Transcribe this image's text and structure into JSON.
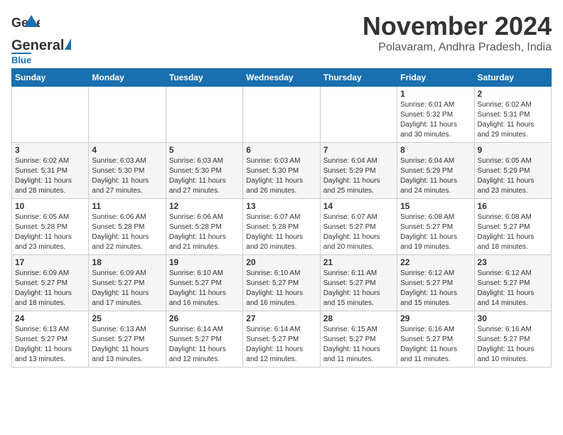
{
  "header": {
    "logo_general": "General",
    "logo_blue": "Blue",
    "month_title": "November 2024",
    "location": "Polavaram, Andhra Pradesh, India"
  },
  "weekdays": [
    "Sunday",
    "Monday",
    "Tuesday",
    "Wednesday",
    "Thursday",
    "Friday",
    "Saturday"
  ],
  "weeks": [
    [
      {
        "day": "",
        "info": ""
      },
      {
        "day": "",
        "info": ""
      },
      {
        "day": "",
        "info": ""
      },
      {
        "day": "",
        "info": ""
      },
      {
        "day": "",
        "info": ""
      },
      {
        "day": "1",
        "info": "Sunrise: 6:01 AM\nSunset: 5:32 PM\nDaylight: 11 hours\nand 30 minutes."
      },
      {
        "day": "2",
        "info": "Sunrise: 6:02 AM\nSunset: 5:31 PM\nDaylight: 11 hours\nand 29 minutes."
      }
    ],
    [
      {
        "day": "3",
        "info": "Sunrise: 6:02 AM\nSunset: 5:31 PM\nDaylight: 11 hours\nand 28 minutes."
      },
      {
        "day": "4",
        "info": "Sunrise: 6:03 AM\nSunset: 5:30 PM\nDaylight: 11 hours\nand 27 minutes."
      },
      {
        "day": "5",
        "info": "Sunrise: 6:03 AM\nSunset: 5:30 PM\nDaylight: 11 hours\nand 27 minutes."
      },
      {
        "day": "6",
        "info": "Sunrise: 6:03 AM\nSunset: 5:30 PM\nDaylight: 11 hours\nand 26 minutes."
      },
      {
        "day": "7",
        "info": "Sunrise: 6:04 AM\nSunset: 5:29 PM\nDaylight: 11 hours\nand 25 minutes."
      },
      {
        "day": "8",
        "info": "Sunrise: 6:04 AM\nSunset: 5:29 PM\nDaylight: 11 hours\nand 24 minutes."
      },
      {
        "day": "9",
        "info": "Sunrise: 6:05 AM\nSunset: 5:29 PM\nDaylight: 11 hours\nand 23 minutes."
      }
    ],
    [
      {
        "day": "10",
        "info": "Sunrise: 6:05 AM\nSunset: 5:28 PM\nDaylight: 11 hours\nand 23 minutes."
      },
      {
        "day": "11",
        "info": "Sunrise: 6:06 AM\nSunset: 5:28 PM\nDaylight: 11 hours\nand 22 minutes."
      },
      {
        "day": "12",
        "info": "Sunrise: 6:06 AM\nSunset: 5:28 PM\nDaylight: 11 hours\nand 21 minutes."
      },
      {
        "day": "13",
        "info": "Sunrise: 6:07 AM\nSunset: 5:28 PM\nDaylight: 11 hours\nand 20 minutes."
      },
      {
        "day": "14",
        "info": "Sunrise: 6:07 AM\nSunset: 5:27 PM\nDaylight: 11 hours\nand 20 minutes."
      },
      {
        "day": "15",
        "info": "Sunrise: 6:08 AM\nSunset: 5:27 PM\nDaylight: 11 hours\nand 19 minutes."
      },
      {
        "day": "16",
        "info": "Sunrise: 6:08 AM\nSunset: 5:27 PM\nDaylight: 11 hours\nand 18 minutes."
      }
    ],
    [
      {
        "day": "17",
        "info": "Sunrise: 6:09 AM\nSunset: 5:27 PM\nDaylight: 11 hours\nand 18 minutes."
      },
      {
        "day": "18",
        "info": "Sunrise: 6:09 AM\nSunset: 5:27 PM\nDaylight: 11 hours\nand 17 minutes."
      },
      {
        "day": "19",
        "info": "Sunrise: 6:10 AM\nSunset: 5:27 PM\nDaylight: 11 hours\nand 16 minutes."
      },
      {
        "day": "20",
        "info": "Sunrise: 6:10 AM\nSunset: 5:27 PM\nDaylight: 11 hours\nand 16 minutes."
      },
      {
        "day": "21",
        "info": "Sunrise: 6:11 AM\nSunset: 5:27 PM\nDaylight: 11 hours\nand 15 minutes."
      },
      {
        "day": "22",
        "info": "Sunrise: 6:12 AM\nSunset: 5:27 PM\nDaylight: 11 hours\nand 15 minutes."
      },
      {
        "day": "23",
        "info": "Sunrise: 6:12 AM\nSunset: 5:27 PM\nDaylight: 11 hours\nand 14 minutes."
      }
    ],
    [
      {
        "day": "24",
        "info": "Sunrise: 6:13 AM\nSunset: 5:27 PM\nDaylight: 11 hours\nand 13 minutes."
      },
      {
        "day": "25",
        "info": "Sunrise: 6:13 AM\nSunset: 5:27 PM\nDaylight: 11 hours\nand 13 minutes."
      },
      {
        "day": "26",
        "info": "Sunrise: 6:14 AM\nSunset: 5:27 PM\nDaylight: 11 hours\nand 12 minutes."
      },
      {
        "day": "27",
        "info": "Sunrise: 6:14 AM\nSunset: 5:27 PM\nDaylight: 11 hours\nand 12 minutes."
      },
      {
        "day": "28",
        "info": "Sunrise: 6:15 AM\nSunset: 5:27 PM\nDaylight: 11 hours\nand 11 minutes."
      },
      {
        "day": "29",
        "info": "Sunrise: 6:16 AM\nSunset: 5:27 PM\nDaylight: 11 hours\nand 11 minutes."
      },
      {
        "day": "30",
        "info": "Sunrise: 6:16 AM\nSunset: 5:27 PM\nDaylight: 11 hours\nand 10 minutes."
      }
    ]
  ]
}
